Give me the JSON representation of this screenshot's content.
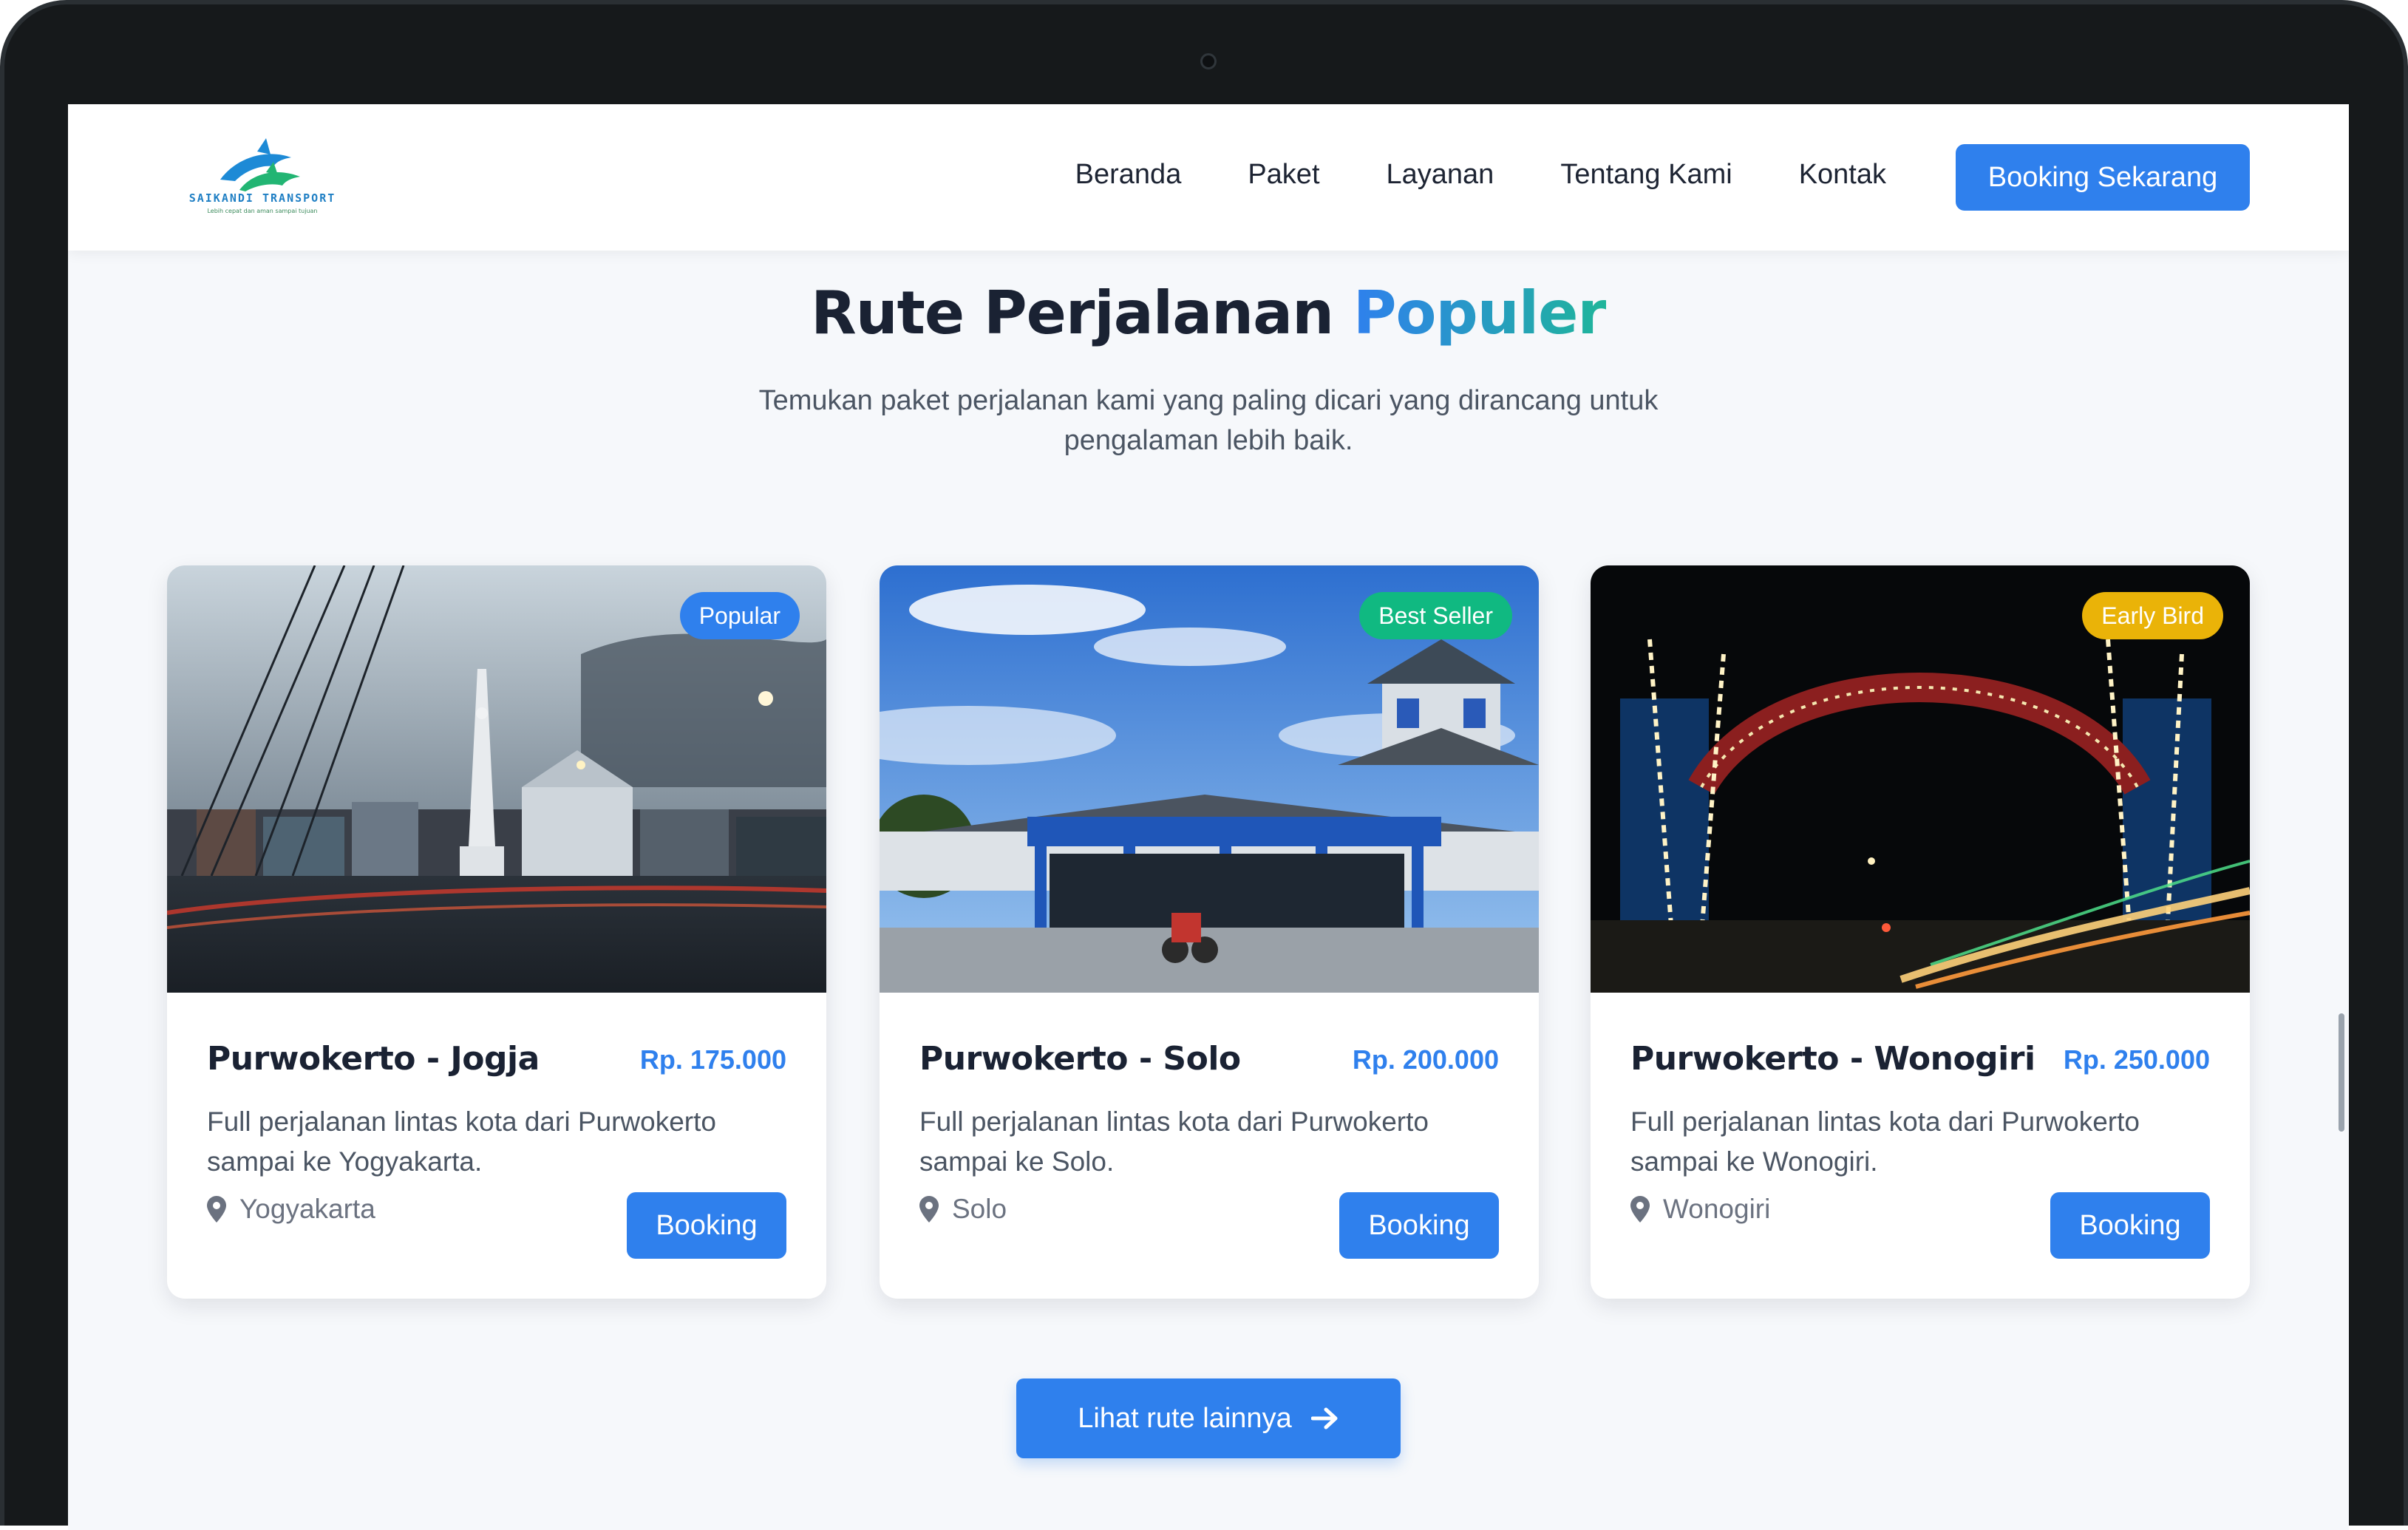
{
  "brand": {
    "name": "SAIKANDI TRANSPORT",
    "tagline": "Lebih cepat dan aman sampai tujuan"
  },
  "nav": {
    "links": [
      "Beranda",
      "Paket",
      "Layanan",
      "Tentang Kami",
      "Kontak"
    ],
    "cta": "Booking Sekarang"
  },
  "section": {
    "title_main": "Rute Perjalanan ",
    "title_accent": "Populer",
    "subtitle": "Temukan paket perjalanan kami yang paling dicari yang dirancang untuk pengalaman lebih baik."
  },
  "cards": [
    {
      "badge": "Popular",
      "badge_color": "#2f80ed",
      "title": "Purwokerto - Jogja",
      "price": "Rp. 175.000",
      "description": "Full perjalanan lintas kota dari Purwokerto sampai ke Yogyakarta.",
      "location": "Yogyakarta",
      "button": "Booking"
    },
    {
      "badge": "Best Seller",
      "badge_color": "#10b981",
      "title": "Purwokerto - Solo",
      "price": "Rp. 200.000",
      "description": "Full perjalanan lintas kota dari Purwokerto sampai ke Solo.",
      "location": "Solo",
      "button": "Booking"
    },
    {
      "badge": "Early Bird",
      "badge_color": "#eab308",
      "title": "Purwokerto - Wonogiri",
      "price": "Rp. 250.000",
      "description": "Full perjalanan lintas kota dari Purwokerto sampai ke Wonogiri.",
      "location": "Wonogiri",
      "button": "Booking"
    }
  ],
  "more_button": "Lihat rute lainnya",
  "colors": {
    "primary": "#2f80ed",
    "accent_gradient_end": "#1fb59a",
    "heading": "#1a2233",
    "background": "#f6f8fb"
  },
  "icons": {
    "location": "map-pin-icon",
    "arrow": "arrow-right-icon",
    "logo": "dolphin-logo-icon"
  }
}
